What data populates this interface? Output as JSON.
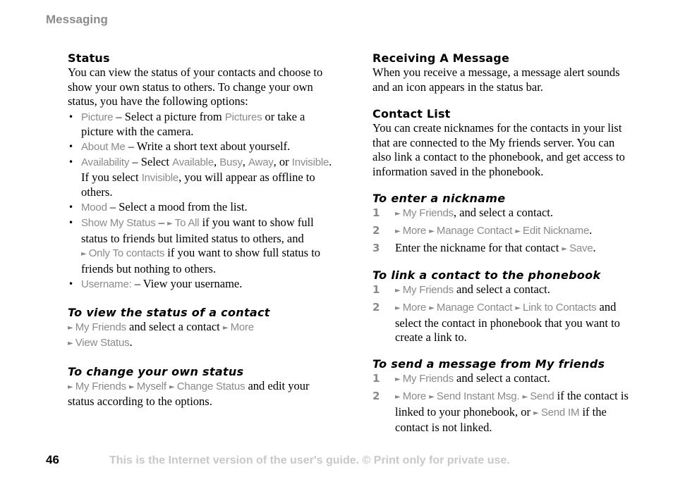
{
  "header": {
    "section_title": "Messaging"
  },
  "left": {
    "status": {
      "heading": "Status",
      "intro": "You can view the status of your contacts and choose to show your own status to others. To change your own status, you have the following options:",
      "bullets": [
        {
          "parts": [
            {
              "t": "ui",
              "v": "Picture"
            },
            {
              "t": "txt",
              "v": " – Select a picture from "
            },
            {
              "t": "ui",
              "v": "Pictures"
            },
            {
              "t": "txt",
              "v": " or take a picture with the camera."
            }
          ]
        },
        {
          "parts": [
            {
              "t": "ui",
              "v": "About Me"
            },
            {
              "t": "txt",
              "v": " – Write a short text about yourself."
            }
          ]
        },
        {
          "parts": [
            {
              "t": "ui",
              "v": "Availability"
            },
            {
              "t": "txt",
              "v": " – Select "
            },
            {
              "t": "ui",
              "v": "Available"
            },
            {
              "t": "txt",
              "v": ", "
            },
            {
              "t": "ui",
              "v": "Busy"
            },
            {
              "t": "txt",
              "v": ", "
            },
            {
              "t": "ui",
              "v": "Away"
            },
            {
              "t": "txt",
              "v": ", or "
            },
            {
              "t": "ui",
              "v": "Invisible"
            },
            {
              "t": "txt",
              "v": ". If you select "
            },
            {
              "t": "ui",
              "v": "Invisible"
            },
            {
              "t": "txt",
              "v": ", you will appear as offline to others."
            }
          ]
        },
        {
          "parts": [
            {
              "t": "ui",
              "v": "Mood"
            },
            {
              "t": "txt",
              "v": " – Select a mood from the list."
            }
          ]
        },
        {
          "parts": [
            {
              "t": "ui",
              "v": "Show My Status"
            },
            {
              "t": "txt",
              "v": " – "
            },
            {
              "t": "arr"
            },
            {
              "t": "ui",
              "v": "To All"
            },
            {
              "t": "txt",
              "v": " if you want to show full status to friends but limited status to others, and "
            },
            {
              "t": "arr"
            },
            {
              "t": "ui",
              "v": "Only To contacts"
            },
            {
              "t": "txt",
              "v": " if you want to show full status to friends but nothing to others."
            }
          ]
        },
        {
          "parts": [
            {
              "t": "ui",
              "v": "Username:"
            },
            {
              "t": "txt",
              "v": " – View your username."
            }
          ]
        }
      ]
    },
    "view_status": {
      "heading": "To view the status of a contact",
      "parts": [
        {
          "t": "arr"
        },
        {
          "t": "ui",
          "v": "My Friends"
        },
        {
          "t": "txt",
          "v": " and select a contact "
        },
        {
          "t": "arr"
        },
        {
          "t": "ui",
          "v": "More"
        },
        {
          "t": "br"
        },
        {
          "t": "arr"
        },
        {
          "t": "ui",
          "v": "View Status"
        },
        {
          "t": "txt",
          "v": "."
        }
      ]
    },
    "change_status": {
      "heading": "To change your own status",
      "parts": [
        {
          "t": "arr"
        },
        {
          "t": "ui",
          "v": "My Friends"
        },
        {
          "t": "txt",
          "v": " "
        },
        {
          "t": "arr"
        },
        {
          "t": "ui",
          "v": "Myself"
        },
        {
          "t": "txt",
          "v": " "
        },
        {
          "t": "arr"
        },
        {
          "t": "ui",
          "v": "Change Status"
        },
        {
          "t": "txt",
          "v": " and edit your status according to the options."
        }
      ]
    }
  },
  "right": {
    "receiving": {
      "heading": "Receiving A Message",
      "body": "When you receive a message, a message alert sounds and an icon appears in the status bar."
    },
    "contact_list": {
      "heading": "Contact List",
      "body": "You can create nicknames for the contacts in your list that are connected to the My friends server. You can also link a contact to the phonebook, and get access to information saved in the phonebook."
    },
    "nickname": {
      "heading": "To enter a nickname",
      "steps": [
        {
          "num": "1",
          "parts": [
            {
              "t": "arr"
            },
            {
              "t": "ui",
              "v": "My Friends"
            },
            {
              "t": "txt",
              "v": ", and select a contact."
            }
          ]
        },
        {
          "num": "2",
          "parts": [
            {
              "t": "arr"
            },
            {
              "t": "ui",
              "v": "More"
            },
            {
              "t": "txt",
              "v": " "
            },
            {
              "t": "arr"
            },
            {
              "t": "ui",
              "v": "Manage Contact"
            },
            {
              "t": "txt",
              "v": " "
            },
            {
              "t": "arr"
            },
            {
              "t": "ui",
              "v": "Edit Nickname"
            },
            {
              "t": "txt",
              "v": "."
            }
          ]
        },
        {
          "num": "3",
          "parts": [
            {
              "t": "txt",
              "v": "Enter the nickname for that contact "
            },
            {
              "t": "arr"
            },
            {
              "t": "ui",
              "v": "Save"
            },
            {
              "t": "txt",
              "v": "."
            }
          ]
        }
      ]
    },
    "link": {
      "heading": "To link a contact to the phonebook",
      "steps": [
        {
          "num": "1",
          "parts": [
            {
              "t": "arr"
            },
            {
              "t": "ui",
              "v": "My Friends"
            },
            {
              "t": "txt",
              "v": " and select a contact."
            }
          ]
        },
        {
          "num": "2",
          "parts": [
            {
              "t": "arr"
            },
            {
              "t": "ui",
              "v": "More"
            },
            {
              "t": "txt",
              "v": " "
            },
            {
              "t": "arr"
            },
            {
              "t": "ui",
              "v": "Manage Contact"
            },
            {
              "t": "txt",
              "v": " "
            },
            {
              "t": "arr"
            },
            {
              "t": "ui",
              "v": "Link to Contacts"
            },
            {
              "t": "txt",
              "v": " and select the contact in phonebook that you want to create a link to."
            }
          ]
        }
      ]
    },
    "send": {
      "heading": "To send a message from My friends",
      "steps": [
        {
          "num": "1",
          "parts": [
            {
              "t": "arr"
            },
            {
              "t": "ui",
              "v": "My Friends"
            },
            {
              "t": "txt",
              "v": " and select a contact."
            }
          ]
        },
        {
          "num": "2",
          "parts": [
            {
              "t": "arr"
            },
            {
              "t": "ui",
              "v": "More"
            },
            {
              "t": "txt",
              "v": " "
            },
            {
              "t": "arr"
            },
            {
              "t": "ui",
              "v": "Send Instant Msg."
            },
            {
              "t": "txt",
              "v": " "
            },
            {
              "t": "arr"
            },
            {
              "t": "ui",
              "v": "Send"
            },
            {
              "t": "txt",
              "v": " if the contact is linked to your phonebook, or "
            },
            {
              "t": "arr"
            },
            {
              "t": "ui",
              "v": "Send IM"
            },
            {
              "t": "txt",
              "v": " if the contact is not linked."
            }
          ]
        }
      ]
    }
  },
  "footer": {
    "page_number": "46",
    "note": "This is the Internet version of the user's guide. © Print only for private use."
  },
  "glyphs": {
    "arrow": "►",
    "bullet": "•"
  },
  "colors": {
    "ui_text": "#8a8a8a",
    "header": "#8c8c8c",
    "footer_note": "#c8c8c8"
  }
}
